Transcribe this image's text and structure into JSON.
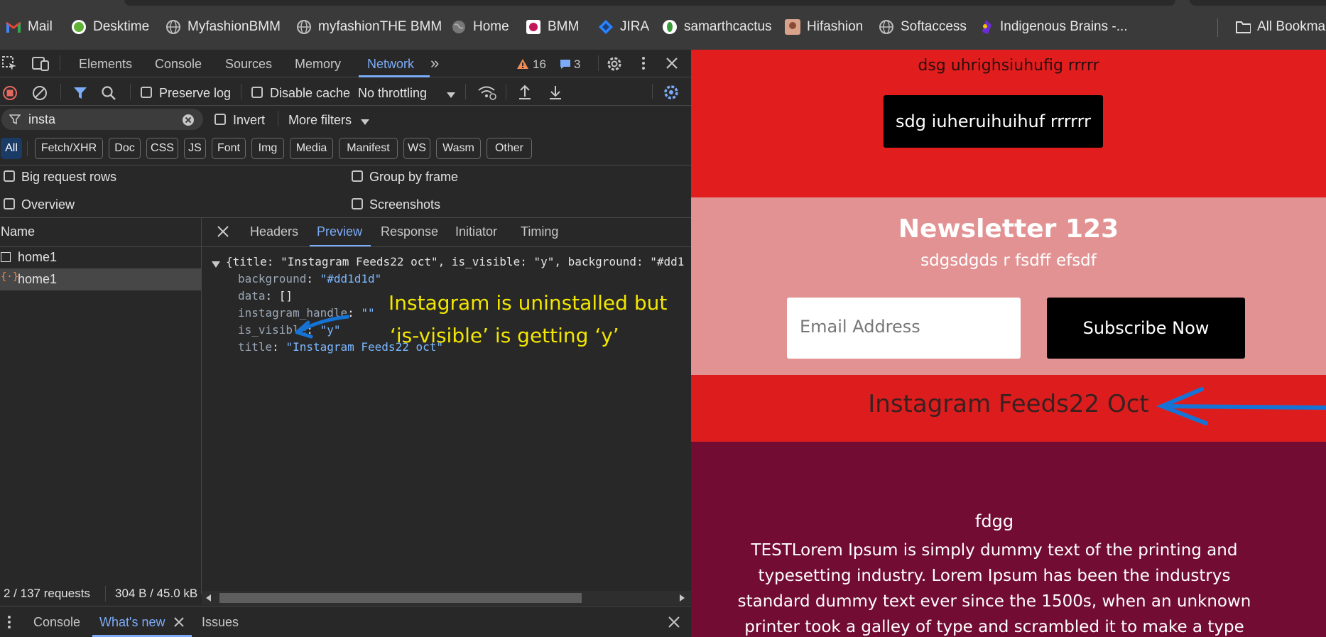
{
  "bookmarks": [
    {
      "label": "Mail",
      "icon": "gmail-icon"
    },
    {
      "label": "Desktime",
      "icon": "desktime-icon"
    },
    {
      "label": "MyfashionBMM",
      "icon": "globe-icon"
    },
    {
      "label": "myfashionTHE BMM",
      "icon": "globe-icon"
    },
    {
      "label": "Home",
      "icon": "globe-icon"
    },
    {
      "label": "BMM",
      "icon": "bmm-icon"
    },
    {
      "label": "JIRA",
      "icon": "jira-icon"
    },
    {
      "label": "samarthcactus",
      "icon": "cactus-icon"
    },
    {
      "label": "Hifashion",
      "icon": "avatar-icon"
    },
    {
      "label": "Softaccess",
      "icon": "globe-icon"
    },
    {
      "label": "Indigenous Brains -...",
      "icon": "ib-icon"
    },
    {
      "label": "All Bookmarks",
      "icon": "folder-icon"
    }
  ],
  "devtools": {
    "tabs": [
      "Elements",
      "Console",
      "Sources",
      "Memory",
      "Network"
    ],
    "active_tab": "Network",
    "warnings_count": "16",
    "messages_count": "3",
    "toolbar": {
      "preserve_log": "Preserve log",
      "disable_cache": "Disable cache",
      "throttling": "No throttling"
    },
    "filter": {
      "value": "insta",
      "invert": "Invert",
      "more_filters": "More filters"
    },
    "type_chips": [
      "All",
      "Fetch/XHR",
      "Doc",
      "CSS",
      "JS",
      "Font",
      "Img",
      "Media",
      "Manifest",
      "WS",
      "Wasm",
      "Other"
    ],
    "options": {
      "big_request_rows": "Big request rows",
      "group_by_frame": "Group by frame",
      "overview": "Overview",
      "screenshots": "Screenshots"
    },
    "requests": {
      "name_header": "Name",
      "rows": [
        "home1",
        "home1"
      ]
    },
    "detail_tabs": [
      "Headers",
      "Preview",
      "Response",
      "Initiator",
      "Timing"
    ],
    "active_detail_tab": "Preview",
    "preview": {
      "summary": "{title: \"Instagram Feeds22 oct\", is_visible: \"y\", background: \"#dd1",
      "fields": [
        {
          "key": "background",
          "value": "\"#dd1d1d\""
        },
        {
          "key": "data",
          "value": "[]"
        },
        {
          "key": "instagram_handle",
          "value": "\"\""
        },
        {
          "key": "is_visible",
          "value": "\"y\""
        },
        {
          "key": "title",
          "value": "\"Instagram Feeds22 oct\""
        }
      ]
    },
    "annotation": {
      "line1": "Instagram is uninstalled but",
      "line2": "‘is-visible’ is getting ‘y’"
    },
    "status": {
      "requests": "2 / 137 requests",
      "size": "304 B / 45.0 kB"
    },
    "drawer_tabs": [
      "Console",
      "What's new",
      "Issues"
    ],
    "active_drawer_tab": "What's new"
  },
  "page": {
    "top_text": "dsg uhrighsiuhufig rrrrr",
    "top_button": "sdg iuheruihuihuf rrrrrr",
    "newsletter_title": "Newsletter 123",
    "newsletter_subtitle": "sdgsdgds r fsdff efsdf",
    "email_placeholder": "Email Address",
    "subscribe_label": "Subscribe Now",
    "instagram_title": "Instagram Feeds22 Oct",
    "footer_heading": "fdgg",
    "footer_lines": [
      "TESTLorem Ipsum is simply dummy text of the printing and",
      "typesetting industry. Lorem Ipsum has been the industrys",
      "standard dummy text ever since the 1500s, when an unknown",
      "printer took a galley of type and scrambled it to make a type"
    ]
  },
  "colors": {
    "accent_blue": "#7cacf8",
    "annotation_yellow": "#f2e600",
    "arrow_blue": "#1673d6",
    "red_section": "#e11d1d",
    "pink_section": "#e29292",
    "instagram_section": "#dd1d1d",
    "maroon_section": "#730c32"
  }
}
